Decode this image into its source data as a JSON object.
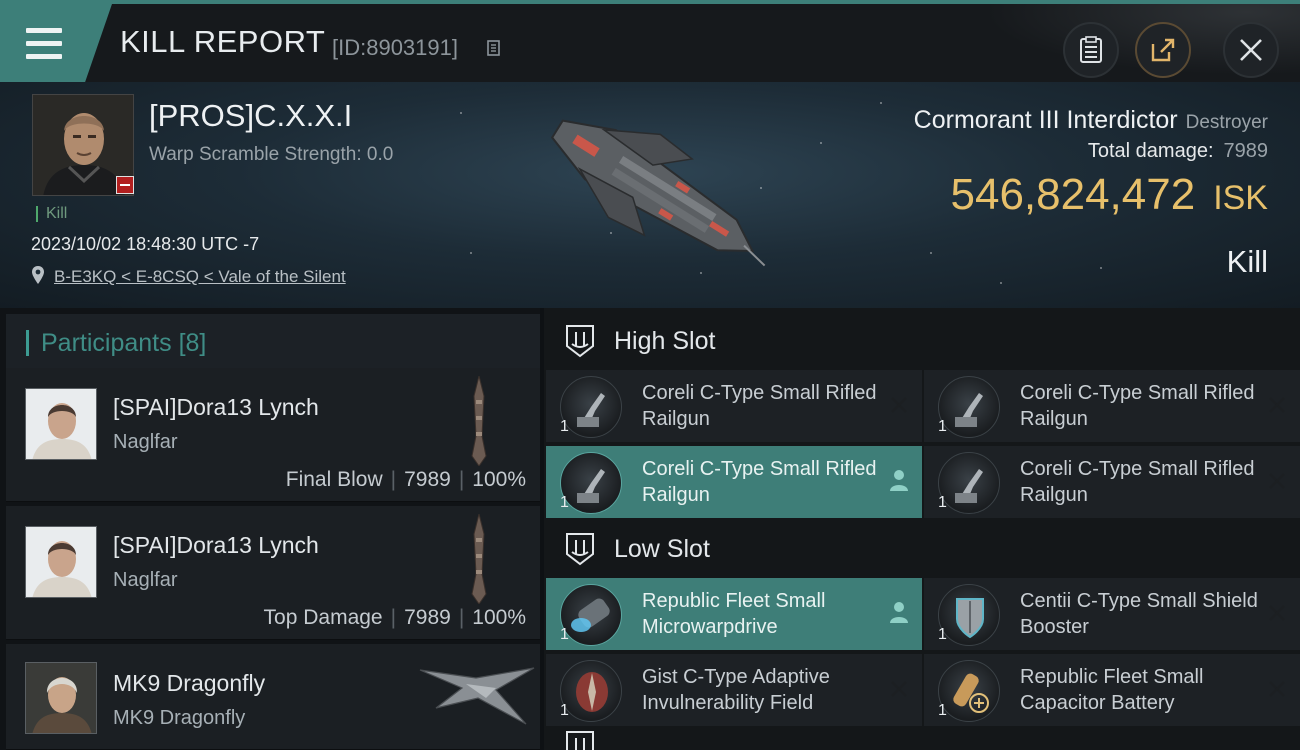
{
  "header": {
    "title": "KILL REPORT",
    "report_id": "[ID:8903191]"
  },
  "victim": {
    "name": "[PROS]C.X.X.I",
    "warp_scramble": "Warp Scramble Strength: 0.0",
    "tag": "Kill",
    "datetime": "2023/10/02 18:48:30 UTC -7",
    "location": "B-E3KQ < E-8CSQ < Vale of the Silent"
  },
  "ship": {
    "name": "Cormorant III Interdictor",
    "class": "Destroyer",
    "total_damage_label": "Total damage:",
    "total_damage_value": "7989",
    "isk_value": "546,824,472",
    "isk_unit": "ISK",
    "result": "Kill"
  },
  "participants": {
    "label": "Participants",
    "count": "[8]",
    "items": [
      {
        "name": "[SPAI]Dora13 Lynch",
        "ship": "Naglfar",
        "role": "Final Blow",
        "damage": "7989",
        "percent": "100%"
      },
      {
        "name": "[SPAI]Dora13 Lynch",
        "ship": "Naglfar",
        "role": "Top Damage",
        "damage": "7989",
        "percent": "100%"
      },
      {
        "name": "MK9 Dragonfly",
        "ship": "MK9 Dragonfly"
      }
    ]
  },
  "fitting": {
    "high_slot_label": "High Slot",
    "low_slot_label": "Low Slot",
    "high": [
      {
        "name": "Coreli C-Type Small Rifled Railgun",
        "qty": "1"
      },
      {
        "name": "Coreli C-Type Small Rifled Railgun",
        "qty": "1"
      },
      {
        "name": "Coreli C-Type Small Rifled Railgun",
        "qty": "1"
      },
      {
        "name": "Coreli C-Type Small Rifled Railgun",
        "qty": "1"
      }
    ],
    "low": [
      {
        "name": "Republic Fleet Small Microwarpdrive",
        "qty": "1"
      },
      {
        "name": "Centii C-Type Small Shield Booster",
        "qty": "1"
      },
      {
        "name": "Gist C-Type Adaptive Invulnerability Field",
        "qty": "1"
      },
      {
        "name": "Republic Fleet Small Capacitor Battery",
        "qty": "1"
      }
    ]
  },
  "colors": {
    "accent": "#3d7f79",
    "isk": "#e7c06b",
    "kill_tag": "#4fa86c",
    "minus_badge": "#b21f1f"
  },
  "icons": [
    "menu-icon",
    "copy-icon",
    "clipboard-icon",
    "share-icon",
    "close-icon",
    "location-pin-icon",
    "slot-icon",
    "railgun-icon",
    "microwarpdrive-icon",
    "shield-booster-icon",
    "invulnerability-field-icon",
    "capacitor-battery-icon",
    "pilot-icon",
    "remove-icon"
  ]
}
